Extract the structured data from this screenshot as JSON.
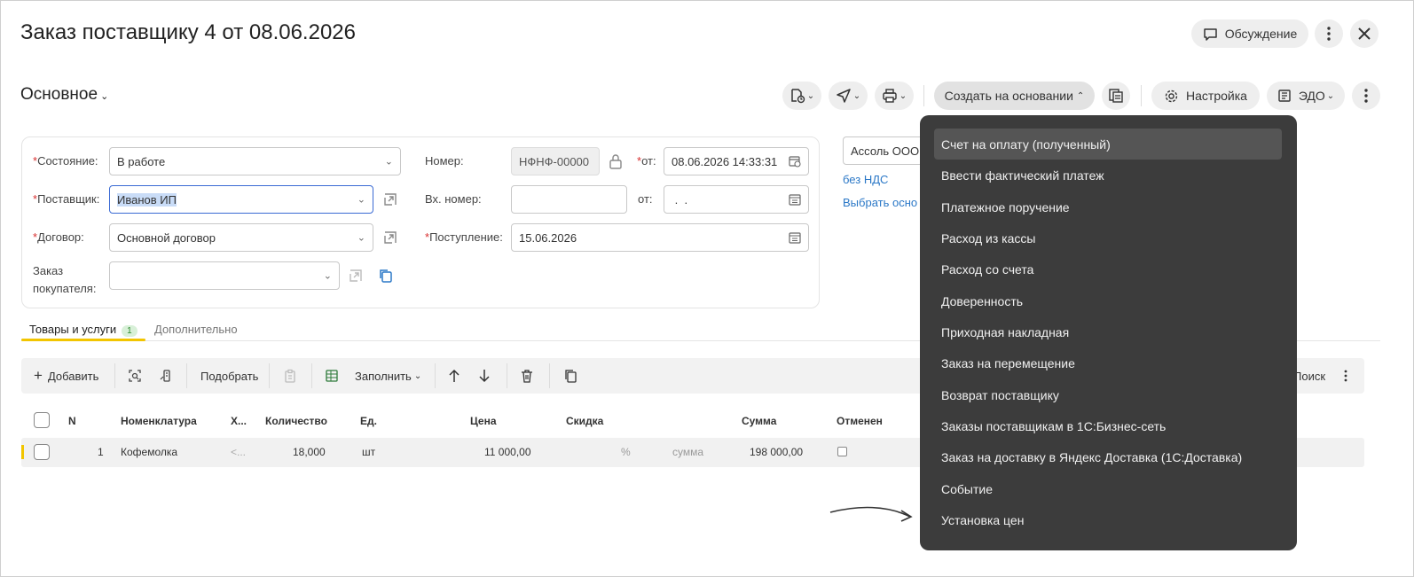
{
  "header": {
    "title": "Заказ поставщику 4 от 08.06.2026",
    "discussion_label": "Обсуждение"
  },
  "toolbar": {
    "section_label": "Основное",
    "create_based_on_label": "Создать на основании",
    "settings_label": "Настройка",
    "edo_label": "ЭДО"
  },
  "form": {
    "state_label": "Состояние:",
    "state_value": "В работе",
    "supplier_label": "Поставщик:",
    "supplier_value": "Иванов ИП",
    "contract_label": "Договор:",
    "contract_value": "Основной договор",
    "customer_order_label_1": "Заказ",
    "customer_order_label_2": "покупателя:",
    "customer_order_value": "",
    "number_label": "Номер:",
    "number_value": "НФНФ-00000",
    "from_label": "от:",
    "from_value": "08.06.2026 14:33:31",
    "in_number_label": "Вх. номер:",
    "in_number_value": "",
    "in_from_label": "от:",
    "in_from_value": " .  . ",
    "arrival_label": "Поступление:",
    "arrival_value": "15.06.2026",
    "org_value": "Ассоль ООО",
    "vat_link": "без НДС",
    "choose_link": "Выбрать осно"
  },
  "tabs": [
    {
      "label": "Товары и услуги",
      "badge": "1"
    },
    {
      "label": "Дополнительно"
    }
  ],
  "table_toolbar": {
    "add_label": "Добавить",
    "pick_label": "Подобрать",
    "fill_label": "Заполнить",
    "search_label": "Поиск"
  },
  "table": {
    "columns": [
      "N",
      "Номенклатура",
      "Х...",
      "Количество",
      "Ед.",
      "Цена",
      "Скидка",
      "Сумма",
      "Отменен"
    ],
    "rows": [
      {
        "n": "1",
        "item": "Кофемолка",
        "char": "<...",
        "qty": "18,000",
        "unit": "шт",
        "price": "11 000,00",
        "discount_pct": "%",
        "discount_sum": "сумма",
        "sum": "198 000,00",
        "cancelled": false
      }
    ]
  },
  "menu": {
    "items": [
      "Счет на оплату (полученный)",
      "Ввести фактический платеж",
      "Платежное поручение",
      "Расход из кассы",
      "Расход со счета",
      "Доверенность",
      "Приходная накладная",
      "Заказ на перемещение",
      "Возврат поставщику",
      "Заказы поставщикам в 1С:Бизнес-сеть",
      "Заказ на доставку в Яндекс Доставка (1С:Доставка)",
      "Событие",
      "Установка цен"
    ],
    "highlighted_index": 0
  }
}
